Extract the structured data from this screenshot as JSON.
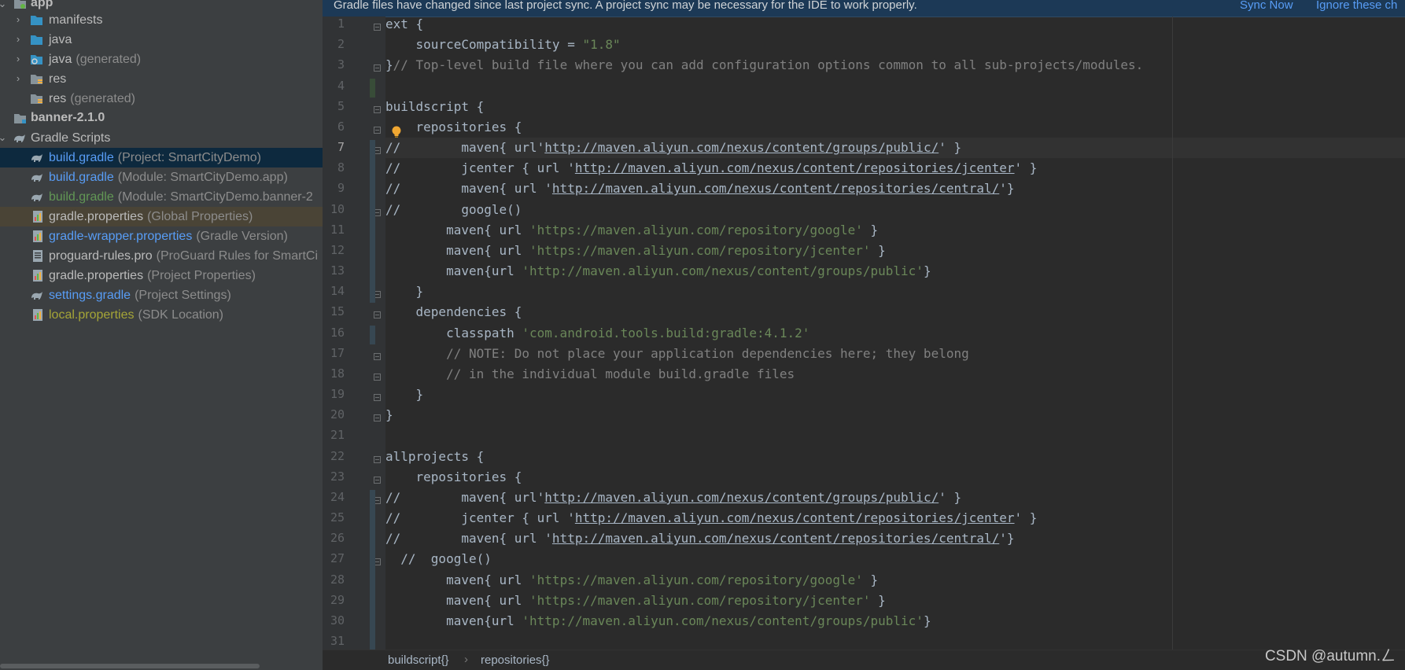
{
  "tree": {
    "items": [
      {
        "name": "app",
        "desc": "",
        "style": "bold"
      },
      {
        "name": "manifests",
        "desc": ""
      },
      {
        "name": "java",
        "desc": ""
      },
      {
        "name": "java",
        "desc": "(generated)"
      },
      {
        "name": "res",
        "desc": ""
      },
      {
        "name": "res",
        "desc": "(generated)"
      },
      {
        "name": "banner-2.1.0",
        "desc": "",
        "style": "bold"
      },
      {
        "name": "Gradle Scripts",
        "desc": ""
      },
      {
        "name": "build.gradle",
        "desc": "(Project: SmartCityDemo)"
      },
      {
        "name": "build.gradle",
        "desc": "(Module: SmartCityDemo.app)"
      },
      {
        "name": "build.gradle",
        "desc": "(Module: SmartCityDemo.banner-2"
      },
      {
        "name": "gradle.properties",
        "desc": "(Global Properties)"
      },
      {
        "name": "gradle-wrapper.properties",
        "desc": "(Gradle Version)"
      },
      {
        "name": "proguard-rules.pro",
        "desc": "(ProGuard Rules for SmartCi"
      },
      {
        "name": "gradle.properties",
        "desc": "(Project Properties)"
      },
      {
        "name": "settings.gradle",
        "desc": "(Project Settings)"
      },
      {
        "name": "local.properties",
        "desc": "(SDK Location)"
      }
    ]
  },
  "banner": {
    "message": "Gradle files have changed since last project sync. A project sync may be necessary for the IDE to work properly.",
    "sync_now": "Sync Now",
    "ignore": "Ignore these ch"
  },
  "editor": {
    "current_line": 7,
    "lines": [
      {
        "n": "1",
        "t": "ext {"
      },
      {
        "n": "2",
        "t": "    sourceCompatibility = \"1.8\""
      },
      {
        "n": "3",
        "t": "}// Top-level build file where you can add configuration options common to all sub-projects/modules."
      },
      {
        "n": "4",
        "t": ""
      },
      {
        "n": "5",
        "t": "buildscript {"
      },
      {
        "n": "6",
        "t": "    repositories {"
      },
      {
        "n": "7",
        "t": "//        maven{ url'http://maven.aliyun.com/nexus/content/groups/public/' }"
      },
      {
        "n": "8",
        "t": "//        jcenter { url 'http://maven.aliyun.com/nexus/content/repositories/jcenter' }"
      },
      {
        "n": "9",
        "t": "//        maven{ url 'http://maven.aliyun.com/nexus/content/repositories/central/'}"
      },
      {
        "n": "10",
        "t": "//        google()"
      },
      {
        "n": "11",
        "t": "        maven{ url 'https://maven.aliyun.com/repository/google' }"
      },
      {
        "n": "12",
        "t": "        maven{ url 'https://maven.aliyun.com/repository/jcenter' }"
      },
      {
        "n": "13",
        "t": "        maven{url 'http://maven.aliyun.com/nexus/content/groups/public'}"
      },
      {
        "n": "14",
        "t": "    }"
      },
      {
        "n": "15",
        "t": "    dependencies {"
      },
      {
        "n": "16",
        "t": "        classpath 'com.android.tools.build:gradle:4.1.2'"
      },
      {
        "n": "17",
        "t": "        // NOTE: Do not place your application dependencies here; they belong"
      },
      {
        "n": "18",
        "t": "        // in the individual module build.gradle files"
      },
      {
        "n": "19",
        "t": "    }"
      },
      {
        "n": "20",
        "t": "}"
      },
      {
        "n": "21",
        "t": ""
      },
      {
        "n": "22",
        "t": "allprojects {"
      },
      {
        "n": "23",
        "t": "    repositories {"
      },
      {
        "n": "24",
        "t": "//        maven{ url'http://maven.aliyun.com/nexus/content/groups/public/' }"
      },
      {
        "n": "25",
        "t": "//        jcenter { url 'http://maven.aliyun.com/nexus/content/repositories/jcenter' }"
      },
      {
        "n": "26",
        "t": "//        maven{ url 'http://maven.aliyun.com/nexus/content/repositories/central/'}"
      },
      {
        "n": "27",
        "t": "  //  google()"
      },
      {
        "n": "28",
        "t": "        maven{ url 'https://maven.aliyun.com/repository/google' }"
      },
      {
        "n": "29",
        "t": "        maven{ url 'https://maven.aliyun.com/repository/jcenter' }"
      },
      {
        "n": "30",
        "t": "        maven{url 'http://maven.aliyun.com/nexus/content/groups/public'}"
      },
      {
        "n": "31",
        "t": ""
      }
    ]
  },
  "breadcrumb": {
    "items": [
      "buildscript{}",
      "repositories{}"
    ]
  },
  "watermark": "CSDN @autumn.ㄥ"
}
